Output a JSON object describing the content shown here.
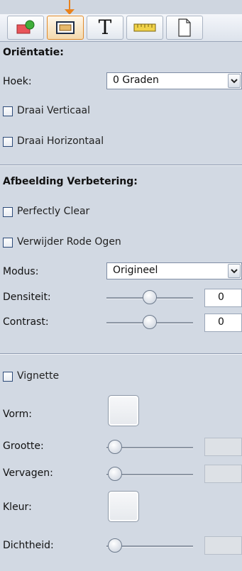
{
  "toolbar": {
    "buttons": [
      {
        "name": "picture-tool",
        "icon": "picture-green-icon",
        "active": false
      },
      {
        "name": "image-frame-tool",
        "icon": "image-frame-icon",
        "active": true
      },
      {
        "name": "text-tool",
        "icon": "text-icon",
        "glyph": "T",
        "active": false
      },
      {
        "name": "ruler-tool",
        "icon": "ruler-icon",
        "active": false
      },
      {
        "name": "page-tool",
        "icon": "page-icon",
        "active": false
      }
    ]
  },
  "orientation": {
    "heading": "Oriëntatie:",
    "angle_label": "Hoek:",
    "angle_value": "0 Graden",
    "flip_vertical": "Draai Verticaal",
    "flip_horizontal": "Draai Horizontaal"
  },
  "enhancement": {
    "heading": "Afbeelding Verbetering:",
    "perfectly_clear": "Perfectly Clear",
    "red_eye": "Verwijder Rode Ogen",
    "mode_label": "Modus:",
    "mode_value": "Origineel",
    "density_label": "Densiteit:",
    "density_value": "0",
    "contrast_label": "Contrast:",
    "contrast_value": "0"
  },
  "vignette": {
    "checkbox_label": "Vignette",
    "shape_label": "Vorm:",
    "size_label": "Grootte:",
    "blur_label": "Vervagen:",
    "color_label": "Kleur:",
    "density_label": "Dichtheid:"
  },
  "colors": {
    "accent": "#e8821e",
    "panel_bg": "#d2d9e3"
  }
}
